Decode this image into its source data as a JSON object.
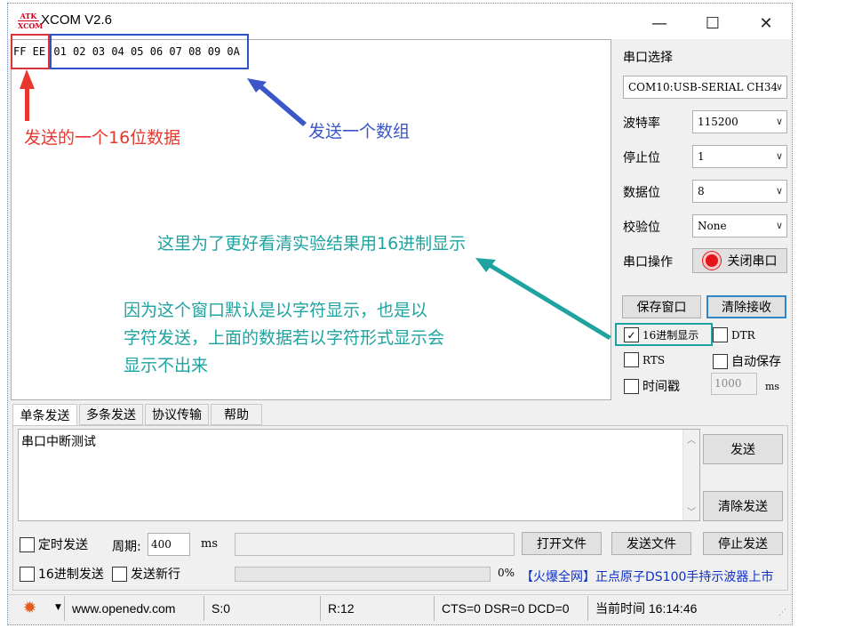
{
  "window": {
    "title": "XCOM V2.6",
    "logo_top": "ATK",
    "logo_bottom": "XCOM",
    "minimize": "—",
    "maximize": "☐",
    "close": "✕"
  },
  "receive": {
    "text_hex_single": "FF EE",
    "text_hex_array": "01 02 03 04 05 06 07 08 09 0A"
  },
  "annotations": {
    "single": "发送的一个16位数据",
    "array": "发送一个数组",
    "hex_note": "这里为了更好看清实验结果用16进制显示",
    "window_note_1": "因为这个窗口默认是以字符显示，也是以",
    "window_note_2": "字符发送，上面的数据若以字符形式显示会",
    "window_note_3": "显示不出来"
  },
  "settings": {
    "port_select_label": "串口选择",
    "port_value": "COM10:USB-SERIAL CH34",
    "baud_label": "波特率",
    "baud_value": "115200",
    "stopbits_label": "停止位",
    "stopbits_value": "1",
    "databits_label": "数据位",
    "databits_value": "8",
    "parity_label": "校验位",
    "parity_value": "None",
    "port_op_label": "串口操作",
    "close_port_button": "关闭串口",
    "save_window_button": "保存窗口",
    "clear_receive_button": "清除接收",
    "hex_display": "16进制显示",
    "dtr": "DTR",
    "rts": "RTS",
    "auto_save": "自动保存",
    "timestamp": "时间戳",
    "timestamp_value": "1000",
    "timestamp_unit": "ms"
  },
  "tabs": [
    "单条发送",
    "多条发送",
    "协议传输",
    "帮助"
  ],
  "send": {
    "text": "串口中断测试",
    "send_button": "发送",
    "clear_send_button": "清除发送",
    "timed_send": "定时发送",
    "period_label": "周期:",
    "period_value": "400",
    "period_unit": "ms",
    "open_file_button": "打开文件",
    "send_file_button": "发送文件",
    "stop_send_button": "停止发送",
    "hex_send": "16进制发送",
    "send_newline": "发送新行",
    "progress": "0%",
    "ad_text": "【火爆全网】正点原子DS100手持示波器上市"
  },
  "status": {
    "website": "www.openedv.com",
    "sent": "S:0",
    "received": "R:12",
    "lines": "CTS=0 DSR=0 DCD=0",
    "time": "当前时间 16:14:46"
  },
  "colors": {
    "red": "#e8382e",
    "blue": "#3a56c9",
    "teal": "#1ea3a0",
    "ad_blue": "#1030c8"
  },
  "icons": {
    "gear": "gear-icon",
    "dropdown": "chevron-down-icon",
    "port_led": "red-led-icon"
  }
}
